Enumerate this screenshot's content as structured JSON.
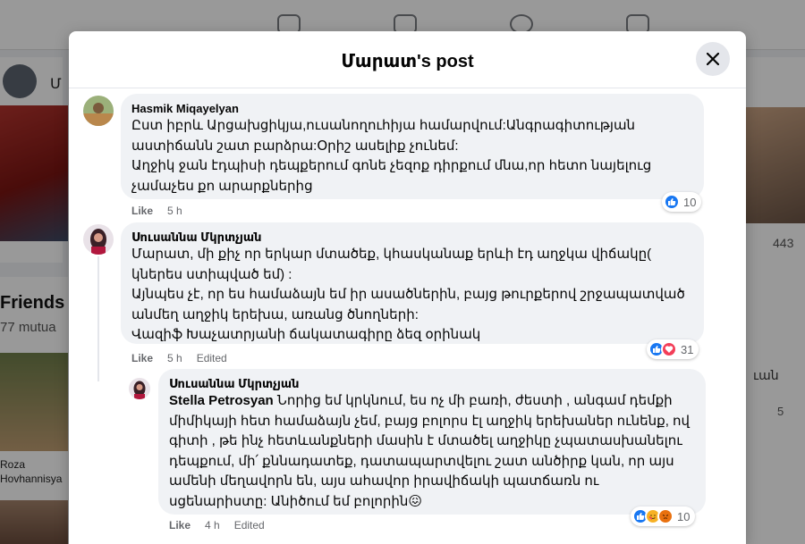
{
  "background": {
    "profile_name": "Մ",
    "friends_title": "Friends",
    "mutual_text": "77 mutua",
    "friend_name_line1": "Roza",
    "friend_name_line2": "Hovhannisya",
    "right_count": "443",
    "right_text": "ւան",
    "right_num": "5"
  },
  "modal": {
    "title": "Մարատ's post",
    "close_icon": "close-icon"
  },
  "comments": [
    {
      "author": "Hasmik Miqayelyan",
      "text": "Ըստ իբրև Արցախցիկյա,ուսանողուհիյա համարվում:Անգրագիտության աստիճանն շատ բարձրա:Օրիշ ասելիք չունեմ:\nԱղջիկ ջան էդպիսի դեպքերում գոնե չեզոք դիրքում մնա,որ հետո նայելուց չամաչես քո արարքներից",
      "like_label": "Like",
      "time": "5 h",
      "reactions": [
        "like-icon"
      ],
      "reaction_count": "10"
    },
    {
      "author": "Սուսաննա Մկրտչյան",
      "text": "Մարատ, մի քիչ որ երկար մտածեք, կհասկանաք երևի էդ աղջկա վիճակը( կներես ստիպված եմ) :\nԱյնպես չէ, որ ես համաձայն եմ իր ասածներին, բայց թուրքերով շրջապատված անմեղ աղջիկ երեխա, առանց ծնողների:\nՎազիֆ Խաչատրյանի ճակատագիրը ձեզ օրինակ",
      "like_label": "Like",
      "time": "5 h",
      "edited": "Edited",
      "reactions": [
        "like-icon",
        "love-icon"
      ],
      "reaction_count": "31"
    },
    {
      "author": "Սուսաննա Մկրտչյան",
      "tag": "Stella Petrosyan",
      "text": "Նորից եմ կրկնում, ես ոչ մի բառի, ժեստի , անգամ դեմքի միմիկայի հետ համաձայն չեմ, բայց բոլորս էլ աղջիկ երեխաներ ունենք, ով գիտի , թե ինչ հետևանքների մասին է մտածել աղջիկը չպատասխանելու դեպքում, մի՛ քննադատեք, դատապարտվելու շատ անծիրք կան, որ այս ամենի մեղավորն են, այս ահավոր իրավիճակի պատճառն ու սցենարիստը: Անիծում եմ բոլորին😖",
      "like_label": "Like",
      "time": "4 h",
      "edited": "Edited",
      "reactions": [
        "like-icon",
        "care-icon",
        "angry-icon"
      ],
      "reaction_count": "10"
    }
  ]
}
